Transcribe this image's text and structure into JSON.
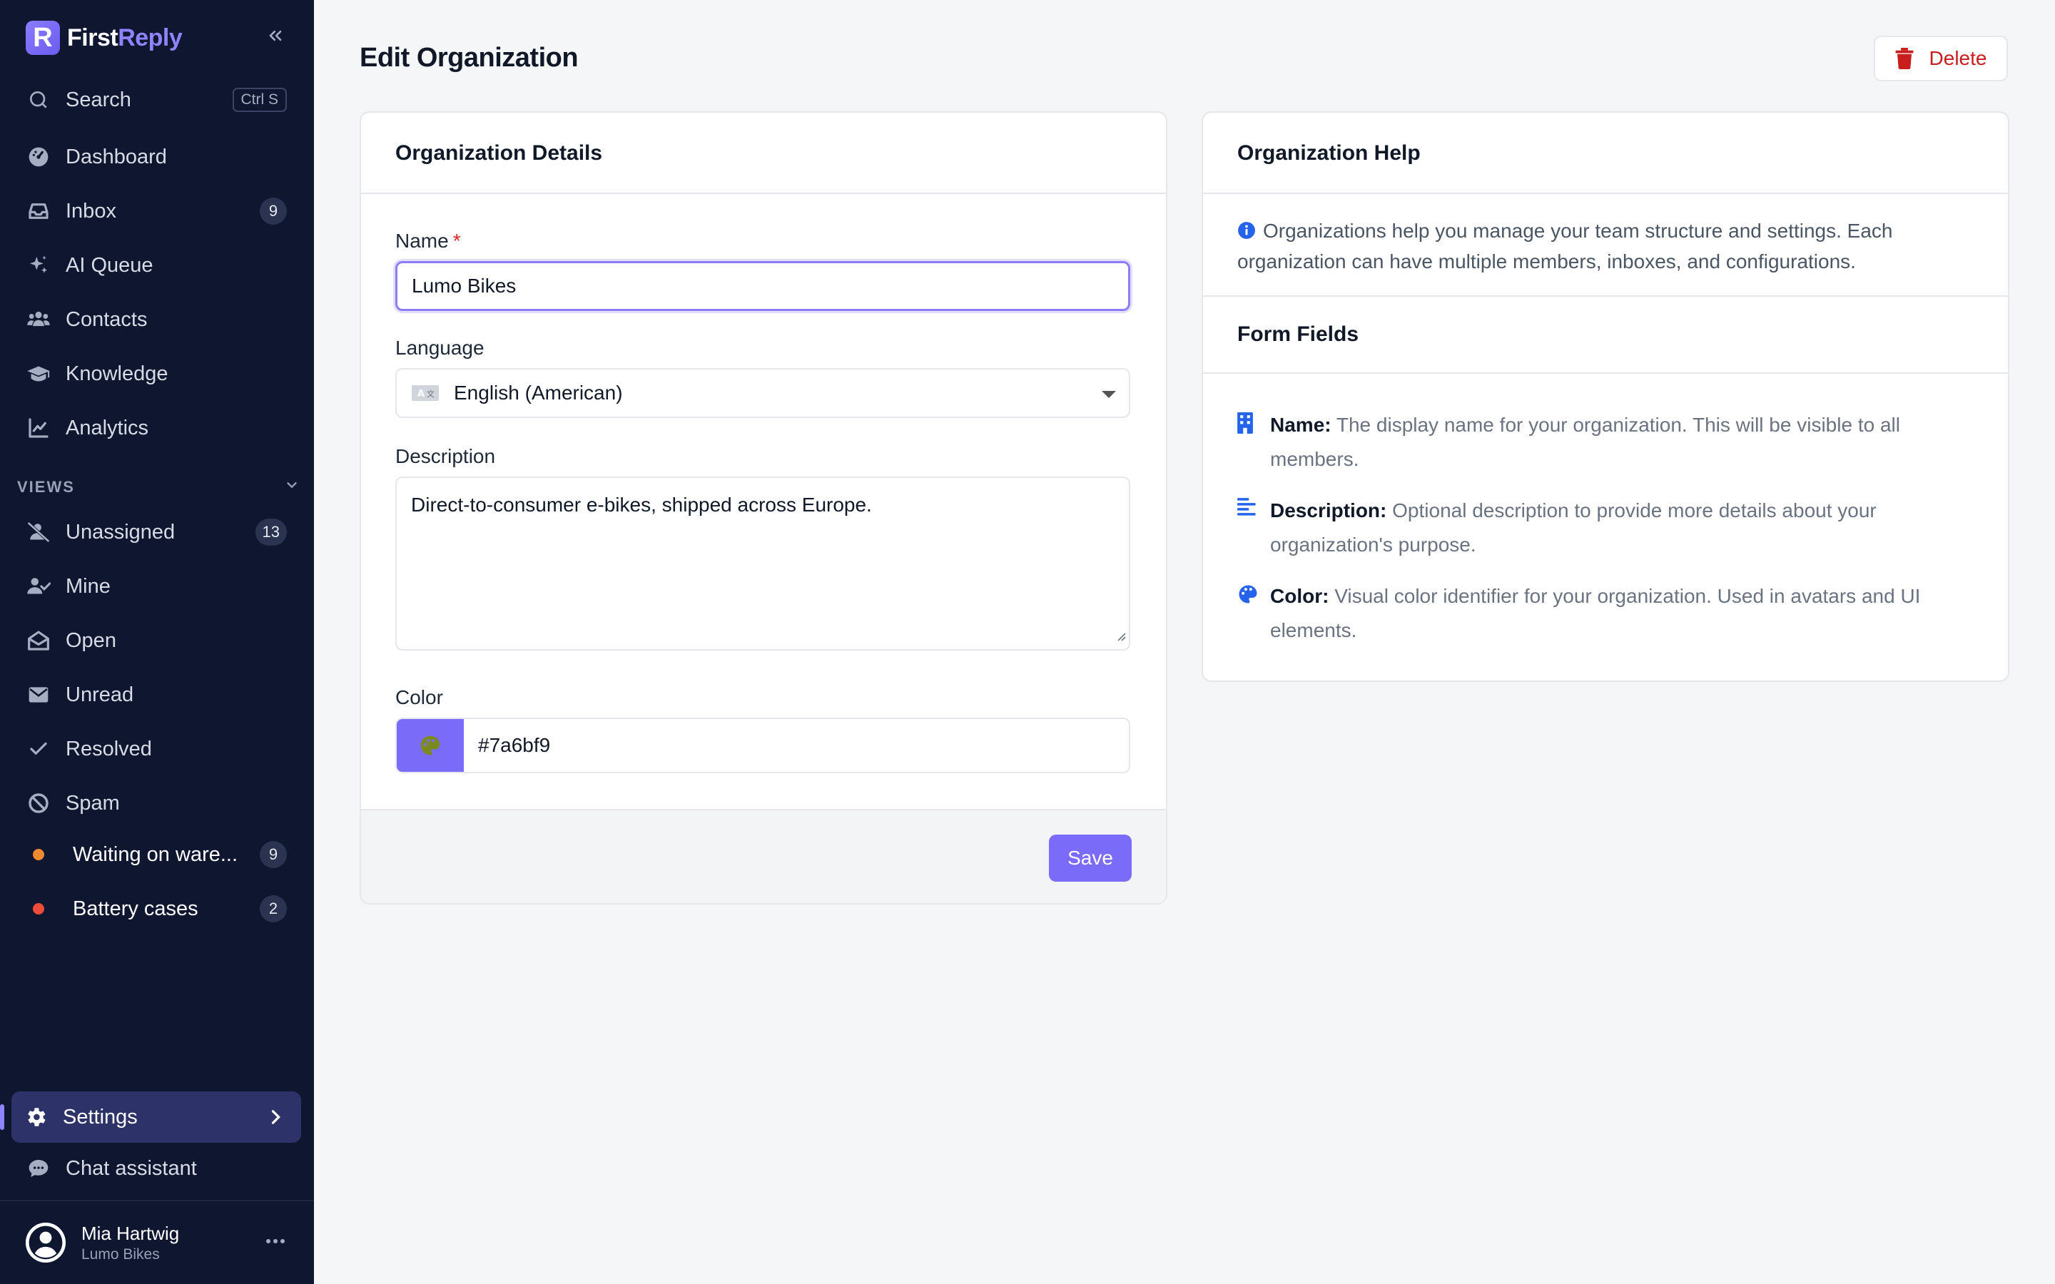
{
  "app": {
    "brand_prefix": "First",
    "brand_accent": "Reply",
    "brand_letter": "R",
    "accent_color": "#7a6bf9"
  },
  "sidebar": {
    "search": {
      "label": "Search",
      "shortcut": "Ctrl S"
    },
    "main_items": [
      {
        "label": "Dashboard",
        "icon": "dashboard-icon"
      },
      {
        "label": "Inbox",
        "icon": "inbox-icon",
        "badge": "9"
      },
      {
        "label": "AI Queue",
        "icon": "sparkle-icon"
      },
      {
        "label": "Contacts",
        "icon": "contacts-icon"
      },
      {
        "label": "Knowledge",
        "icon": "graduation-cap-icon"
      },
      {
        "label": "Analytics",
        "icon": "chart-line-icon"
      }
    ],
    "views_heading": "VIEWS",
    "views": [
      {
        "label": "Unassigned",
        "icon": "user-slash-icon",
        "badge": "13"
      },
      {
        "label": "Mine",
        "icon": "user-check-icon"
      },
      {
        "label": "Open",
        "icon": "envelope-open-icon"
      },
      {
        "label": "Unread",
        "icon": "envelope-icon"
      },
      {
        "label": "Resolved",
        "icon": "check-icon"
      },
      {
        "label": "Spam",
        "icon": "ban-icon"
      },
      {
        "label": "Waiting on ware...",
        "dot_color": "#f0892f",
        "badge": "9"
      },
      {
        "label": "Battery cases",
        "dot_color": "#ee4b3a",
        "badge": "2"
      }
    ],
    "settings_label": "Settings",
    "chat_label": "Chat assistant",
    "user": {
      "name": "Mia Hartwig",
      "org": "Lumo Bikes"
    }
  },
  "main": {
    "title": "Edit Organization",
    "delete_label": "Delete",
    "details": {
      "title": "Organization Details",
      "name_label": "Name",
      "required_mark": "*",
      "name_value": "Lumo Bikes",
      "language_label": "Language",
      "language_value": "English (American)",
      "description_label": "Description",
      "description_value": "Direct-to-consumer e-bikes, shipped across Europe.",
      "color_label": "Color",
      "color_value": "#7a6bf9",
      "save_label": "Save"
    },
    "help": {
      "title": "Organization Help",
      "intro": "Organizations help you manage your team structure and settings. Each organization can have multiple members, inboxes, and configurations.",
      "fields_title": "Form Fields",
      "fields": [
        {
          "term": "Name:",
          "text": "The display name for your organization. This will be visible to all members."
        },
        {
          "term": "Description:",
          "text": "Optional description to provide more details about your organization's purpose."
        },
        {
          "term": "Color:",
          "text": "Visual color identifier for your organization. Used in avatars and UI elements."
        }
      ]
    }
  }
}
